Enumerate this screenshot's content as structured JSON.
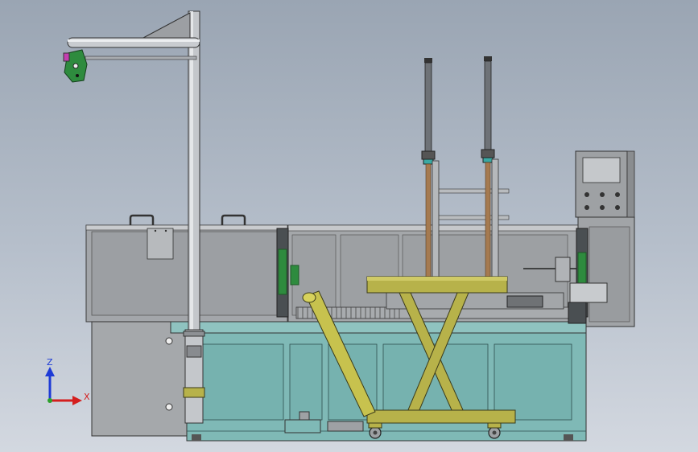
{
  "viewport": {
    "background": "#b4bdc9"
  },
  "axis_triad": {
    "z_label": "Z",
    "x_label": "X"
  },
  "colors": {
    "cabinet": "#7fb9b6",
    "frame_gray": "#a7a9ac",
    "lift_olive": "#b7b24a",
    "bracket_green": "#2e8b3e",
    "post_gray": "#c4c7cb"
  }
}
